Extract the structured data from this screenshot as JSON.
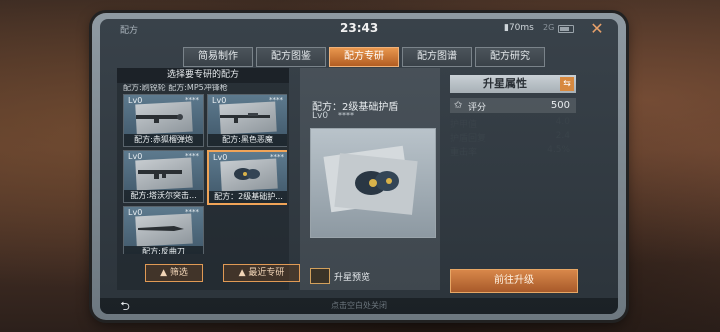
{
  "status": {
    "title": "配方",
    "time": "23:43",
    "ping": "70ms",
    "net": "2G"
  },
  "tabs": [
    "简易制作",
    "配方图鉴",
    "配方专研",
    "配方图谱",
    "配方研究"
  ],
  "active_tab": 2,
  "left": {
    "header": "选择要专研的配方",
    "partial_row": "配方:刷锐轮    配方:MP5冲锋枪",
    "cards": [
      {
        "lv": "Lv0",
        "stars": "****",
        "name": "配方:赤狐榴弹炮",
        "icon": "grenade-launcher-icon"
      },
      {
        "lv": "Lv0",
        "stars": "****",
        "name": "配方:黑色恶魔",
        "icon": "rifle-icon"
      },
      {
        "lv": "Lv0",
        "stars": "****",
        "name": "配方:塔沃尔突击...",
        "icon": "assault-rifle-icon"
      },
      {
        "lv": "Lv0",
        "stars": "****",
        "name": "配方：2级基础护...",
        "icon": "shield-icon"
      },
      {
        "lv": "Lv0",
        "stars": "****",
        "name": "配方:反曲刀",
        "icon": "machete-icon"
      }
    ],
    "filter_label": "筛选",
    "recent_label": "最近专研"
  },
  "detail": {
    "title": "配方：2级基础护盾",
    "lv": "Lv0",
    "stars": "****",
    "preview_label": "升星预览"
  },
  "attrs": {
    "title": "升星属性",
    "score_label": "评分",
    "score_value": "500",
    "stats": [
      {
        "label": "护甲值",
        "value": "4.0"
      },
      {
        "label": "护盾回复",
        "value": "2.4"
      },
      {
        "label": "重击率",
        "value": "4.5%"
      }
    ],
    "go_label": "前往升级"
  },
  "bottom": {
    "hint": "点击空白处关闭"
  },
  "colors": {
    "accent": "#e8974e",
    "selected_border": "#f0a458"
  }
}
